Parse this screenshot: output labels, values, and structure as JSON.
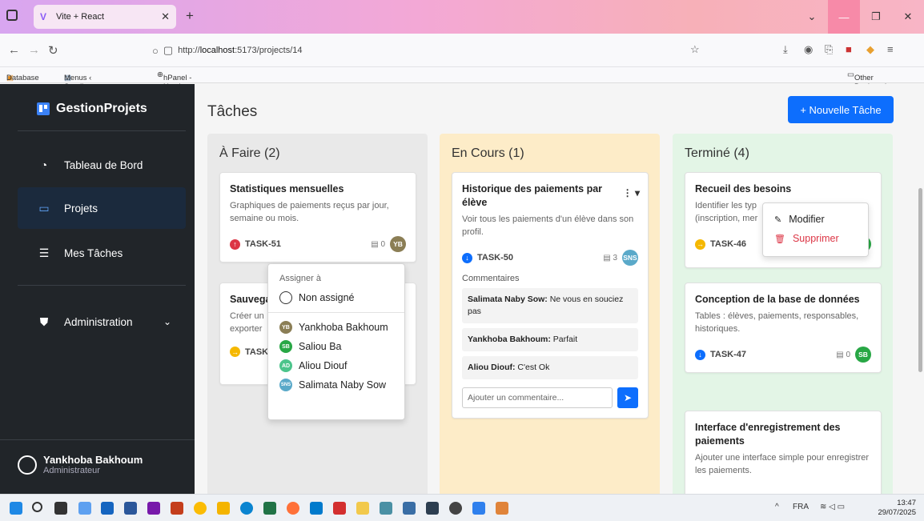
{
  "browser": {
    "tab_title": "Vite + React",
    "url_prefix": "http://",
    "url_host": "localhost",
    "url_path": ":5173/projects/14",
    "bookmarks": [
      "Database",
      "Menus ‹ Sendiwaan —...",
      "hPanel - Hostinger"
    ],
    "other_bookmarks": "Other Bookmarks"
  },
  "sidebar": {
    "brand": "GestionProjets",
    "items": [
      {
        "label": "Tableau de Bord",
        "icon": "speedometer-icon"
      },
      {
        "label": "Projets",
        "icon": "folder-icon"
      },
      {
        "label": "Mes Tâches",
        "icon": "list-icon"
      },
      {
        "label": "Administration",
        "icon": "shield-icon"
      }
    ],
    "user": {
      "name": "Yankhoba Bakhoum",
      "role": "Administrateur"
    }
  },
  "main": {
    "title": "Tâches",
    "new_task_label": "+ Nouvelle Tâche",
    "columns": [
      {
        "title": "À Faire (2)",
        "color": "#e9e9e9"
      },
      {
        "title": "En Cours (1)",
        "color": "#fdecc8"
      },
      {
        "title": "Terminé (4)",
        "color": "#e3f5e6"
      }
    ],
    "todo_cards": [
      {
        "title": "Statistiques mensuelles",
        "desc": "Graphiques de paiements reçus par jour, semaine ou mois.",
        "task": "TASK-51",
        "comments": "0",
        "avatar": "YB"
      },
      {
        "title": "Sauvega",
        "desc": "Créer un",
        "desc2": "exporter",
        "task": "TASK"
      }
    ],
    "assign_menu": {
      "header": "Assigner à",
      "unassigned": "Non assigné",
      "users": [
        {
          "initials": "YB",
          "name": "Yankhoba Bakhoum",
          "color": "#8b7e55"
        },
        {
          "initials": "SB",
          "name": "Saliou Ba",
          "color": "#28a745"
        },
        {
          "initials": "AD",
          "name": "Aliou Diouf",
          "color": "#4cc48b"
        },
        {
          "initials": "SNS",
          "name": "Salimata Naby Sow",
          "color": "#5aa9c9"
        }
      ]
    },
    "inprogress_card": {
      "title": "Historique des paiements par élève",
      "desc": "Voir tous les paiements d'un élève dans son profil.",
      "task": "TASK-50",
      "comments_count": "3",
      "avatar": "SNS",
      "comments_label": "Commentaires",
      "comments": [
        {
          "author": "Salimata Naby Sow:",
          "text": "Ne vous en souciez pas"
        },
        {
          "author": "Yankhoba Bakhoum:",
          "text": "Parfait"
        },
        {
          "author": "Aliou Diouf:",
          "text": "C'est Ok"
        }
      ],
      "comment_placeholder": "Ajouter un commentaire..."
    },
    "done_cards": [
      {
        "title": "Recueil des besoins",
        "desc": "Identifier les typ",
        "desc2": "(inscription, mer",
        "task": "TASK-46"
      },
      {
        "title": "Conception de la base de données",
        "desc": "Tables : élèves, paiements, responsables, historiques.",
        "task": "TASK-47",
        "comments": "0",
        "avatar": "SB"
      },
      {
        "title": "Interface d'enregistrement des paiements",
        "desc": "Ajouter une interface simple pour enregistrer les paiements."
      }
    ],
    "context_menu": {
      "edit": "Modifier",
      "delete": "Supprimer"
    }
  },
  "taskbar": {
    "lang": "FRA",
    "time": "13:47",
    "date": "29/07/2025"
  },
  "colors": {
    "primary": "#0d6efd",
    "sidebar": "#212529",
    "danger": "#dc3545",
    "warning": "#f5b800"
  }
}
